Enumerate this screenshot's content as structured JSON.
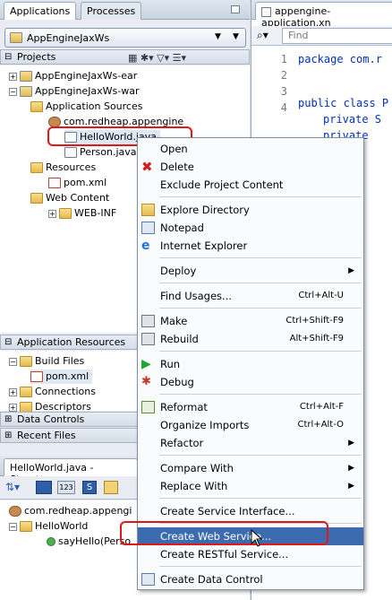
{
  "left_panel": {
    "tabs": [
      "Applications",
      "Processes"
    ],
    "app_selector": "AppEngineJaxWs",
    "projects_header": "Projects",
    "tree": [
      {
        "label": "AppEngineJaxWs-ear"
      },
      {
        "label": "AppEngineJaxWs-war"
      },
      {
        "label": "Application Sources"
      },
      {
        "label": "com.redheap.appengine"
      },
      {
        "label": "HelloWorld.java"
      },
      {
        "label": "Person.java"
      },
      {
        "label": "Resources"
      },
      {
        "label": "pom.xml"
      },
      {
        "label": "Web Content"
      },
      {
        "label": "WEB-INF"
      }
    ],
    "app_resources_header": "Application Resources",
    "app_resources_tree": [
      {
        "label": "Build Files"
      },
      {
        "label": "pom.xml"
      },
      {
        "label": "Connections"
      },
      {
        "label": "Descriptors"
      }
    ],
    "data_controls": "Data Controls",
    "recent_files": "Recent Files",
    "structure_tab": "HelloWorld.java - Structure",
    "structure_tree": [
      {
        "label": "com.redheap.appengi"
      },
      {
        "label": "HelloWorld"
      },
      {
        "label": "sayHello(Perso"
      }
    ]
  },
  "editor": {
    "tab_label": "appengine-application.xn",
    "search_placeholder": "Find",
    "line_numbers": [
      "1",
      "2",
      "3",
      "4"
    ],
    "code_lines": [
      "package com.r",
      "public class P",
      "private S",
      "private"
    ]
  },
  "context_menu": {
    "items": [
      {
        "label": "Open",
        "shortcut": "",
        "submenu": false,
        "icon": "none"
      },
      {
        "label": "Delete",
        "shortcut": "",
        "submenu": false,
        "icon": "delete-icon"
      },
      {
        "label": "Exclude Project Content",
        "shortcut": "",
        "submenu": false,
        "icon": "none"
      },
      {
        "label": "Explore Directory",
        "shortcut": "",
        "submenu": false,
        "icon": "folder-icon"
      },
      {
        "label": "Notepad",
        "shortcut": "",
        "submenu": false,
        "icon": "notepad-icon"
      },
      {
        "label": "Internet Explorer",
        "shortcut": "",
        "submenu": false,
        "icon": "ie-icon"
      },
      {
        "label": "Deploy",
        "shortcut": "",
        "submenu": true,
        "icon": "none"
      },
      {
        "label": "Find Usages...",
        "shortcut": "Ctrl+Alt-U",
        "submenu": false,
        "icon": "none"
      },
      {
        "label": "Make",
        "shortcut": "Ctrl+Shift-F9",
        "submenu": false,
        "icon": "make-icon"
      },
      {
        "label": "Rebuild",
        "shortcut": "Alt+Shift-F9",
        "submenu": false,
        "icon": "rebuild-icon"
      },
      {
        "label": "Run",
        "shortcut": "",
        "submenu": false,
        "icon": "run-icon"
      },
      {
        "label": "Debug",
        "shortcut": "",
        "submenu": false,
        "icon": "debug-icon"
      },
      {
        "label": "Reformat",
        "shortcut": "Ctrl+Alt-F",
        "submenu": false,
        "icon": "reformat-icon"
      },
      {
        "label": "Organize Imports",
        "shortcut": "Ctrl+Alt-O",
        "submenu": false,
        "icon": "none"
      },
      {
        "label": "Refactor",
        "shortcut": "",
        "submenu": true,
        "icon": "none"
      },
      {
        "label": "Compare With",
        "shortcut": "",
        "submenu": true,
        "icon": "none"
      },
      {
        "label": "Replace With",
        "shortcut": "",
        "submenu": true,
        "icon": "none"
      },
      {
        "label": "Create Service Interface...",
        "shortcut": "",
        "submenu": false,
        "icon": "none"
      },
      {
        "label": "Create Web Service...",
        "shortcut": "",
        "submenu": false,
        "icon": "none",
        "highlighted": true
      },
      {
        "label": "Create RESTful Service...",
        "shortcut": "",
        "submenu": false,
        "icon": "none"
      },
      {
        "label": "Create Data Control",
        "shortcut": "",
        "submenu": false,
        "icon": "data-control-icon"
      }
    ]
  },
  "colors": {
    "highlight": "#3d6bb0",
    "annotation_box": "#e01818"
  }
}
